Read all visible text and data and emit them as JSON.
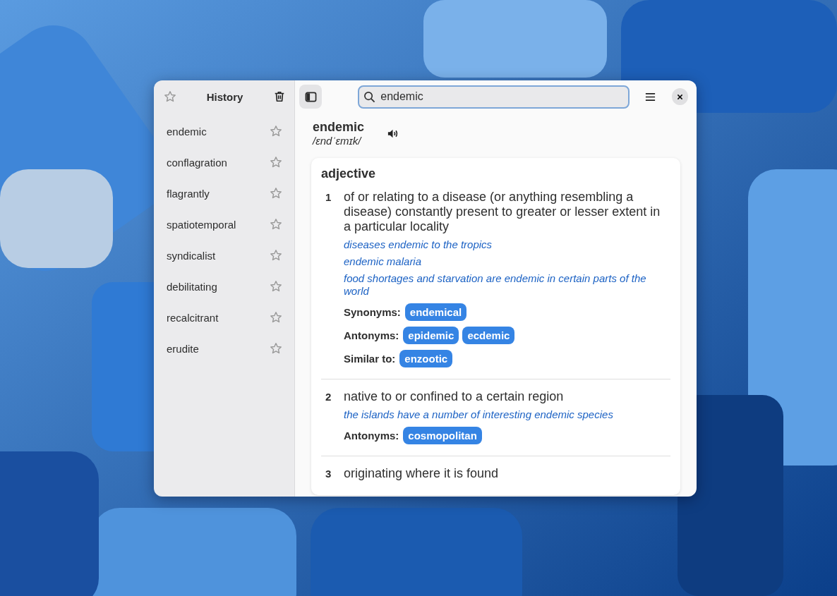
{
  "sidebar": {
    "title": "History",
    "items": [
      {
        "label": "endemic",
        "starred": false
      },
      {
        "label": "conflagration",
        "starred": false
      },
      {
        "label": "flagrantly",
        "starred": false
      },
      {
        "label": "spatiotemporal",
        "starred": false
      },
      {
        "label": "syndicalist",
        "starred": false
      },
      {
        "label": "debilitating",
        "starred": false
      },
      {
        "label": "recalcitrant",
        "starred": false
      },
      {
        "label": "erudite",
        "starred": false
      }
    ]
  },
  "search": {
    "value": "endemic"
  },
  "entry": {
    "word": "endemic",
    "pronunciation": "/ɛndˈɛmɪk/",
    "sections": [
      {
        "part_of_speech": "adjective",
        "senses": [
          {
            "number": "1",
            "definition": "of or relating to a disease (or anything resembling a disease) constantly present to greater or lesser extent in a particular locality",
            "examples": [
              "diseases endemic to the tropics",
              "endemic malaria",
              "food shortages and starvation are endemic in certain parts of the world"
            ],
            "relations": [
              {
                "label": "Synonyms:",
                "words": [
                  "endemical"
                ]
              },
              {
                "label": "Antonyms:",
                "words": [
                  "epidemic",
                  "ecdemic"
                ]
              },
              {
                "label": "Similar to:",
                "words": [
                  "enzootic"
                ]
              }
            ]
          },
          {
            "number": "2",
            "definition": "native to or confined to a certain region",
            "examples": [
              "the islands have a number of interesting endemic species"
            ],
            "relations": [
              {
                "label": "Antonyms:",
                "words": [
                  "cosmopolitan"
                ]
              }
            ]
          },
          {
            "number": "3",
            "definition": "originating where it is found"
          }
        ]
      }
    ]
  }
}
